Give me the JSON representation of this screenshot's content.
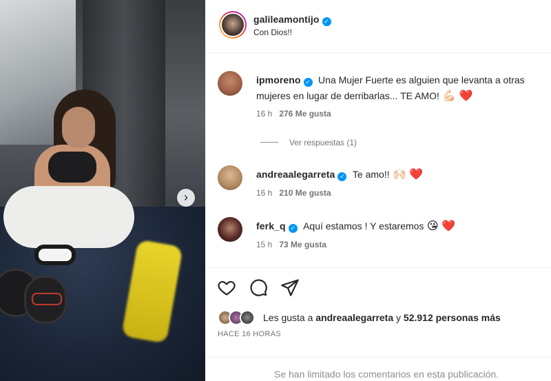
{
  "post": {
    "username": "galileamontijo",
    "caption": "Con Dios!!",
    "likes_prefix": "Les gusta a",
    "likes_user": "andreaalegarreta",
    "likes_joiner": "y",
    "likes_count": "52.912 personas más",
    "time_ago": "HACE 16 HORAS",
    "comments_limited": "Se han limitado los comentarios en esta publicación."
  },
  "comments": [
    {
      "username": "ipmoreno",
      "text": "Una Mujer Fuerte es alguien que levanta a otras mujeres en lugar de derribarlas... TE AMO!",
      "emojis": "💪🏻 ❤️",
      "time": "16 h",
      "likes": "276 Me gusta",
      "replies": "Ver respuestas (1)"
    },
    {
      "username": "andreaalegarreta",
      "text": "Te amo!!",
      "emojis": "🙌🏻 ❤️",
      "time": "16 h",
      "likes": "210 Me gusta"
    },
    {
      "username": "ferk_q",
      "text": "Aquí estamos ! Y estaremos",
      "emojis": "😘 ❤️",
      "time": "15 h",
      "likes": "73 Me gusta"
    }
  ],
  "icons": {
    "verified": "verified-badge-icon",
    "like": "heart-icon",
    "comment": "comment-bubble-icon",
    "share": "paper-plane-icon",
    "next": "chevron-right-icon"
  },
  "colors": {
    "verified": "#0095f6",
    "heart": "#ed4956",
    "meta": "#737373"
  }
}
